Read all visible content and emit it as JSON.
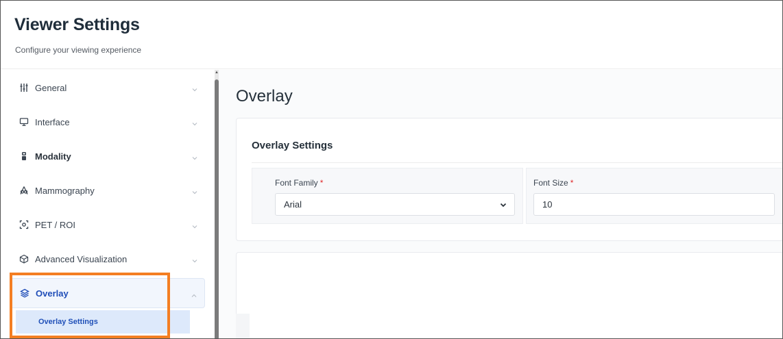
{
  "header": {
    "title": "Viewer Settings",
    "subtitle": "Configure your viewing experience"
  },
  "sidebar": {
    "items": [
      {
        "label": "General",
        "icon": "sliders-icon",
        "bold": false
      },
      {
        "label": "Interface",
        "icon": "monitor-icon",
        "bold": false
      },
      {
        "label": "Modality",
        "icon": "scanner-icon",
        "bold": true
      },
      {
        "label": "Mammography",
        "icon": "mammography-icon",
        "bold": false
      },
      {
        "label": "PET / ROI",
        "icon": "focus-icon",
        "bold": false
      },
      {
        "label": "Advanced Visualization",
        "icon": "cube-icon",
        "bold": false
      },
      {
        "label": "Overlay",
        "icon": "layers-icon",
        "bold": true,
        "active": true
      }
    ],
    "sub_item": {
      "label": "Overlay Settings"
    }
  },
  "main": {
    "page_title": "Overlay",
    "card": {
      "title": "Overlay Settings",
      "font_family": {
        "label": "Font Family",
        "required_mark": "*",
        "value": "Arial"
      },
      "font_size": {
        "label": "Font Size",
        "required_mark": "*",
        "value": "10"
      }
    }
  },
  "colors": {
    "accent": "#1f4db8",
    "highlight": "#f47e22",
    "required": "#e02a2a"
  }
}
